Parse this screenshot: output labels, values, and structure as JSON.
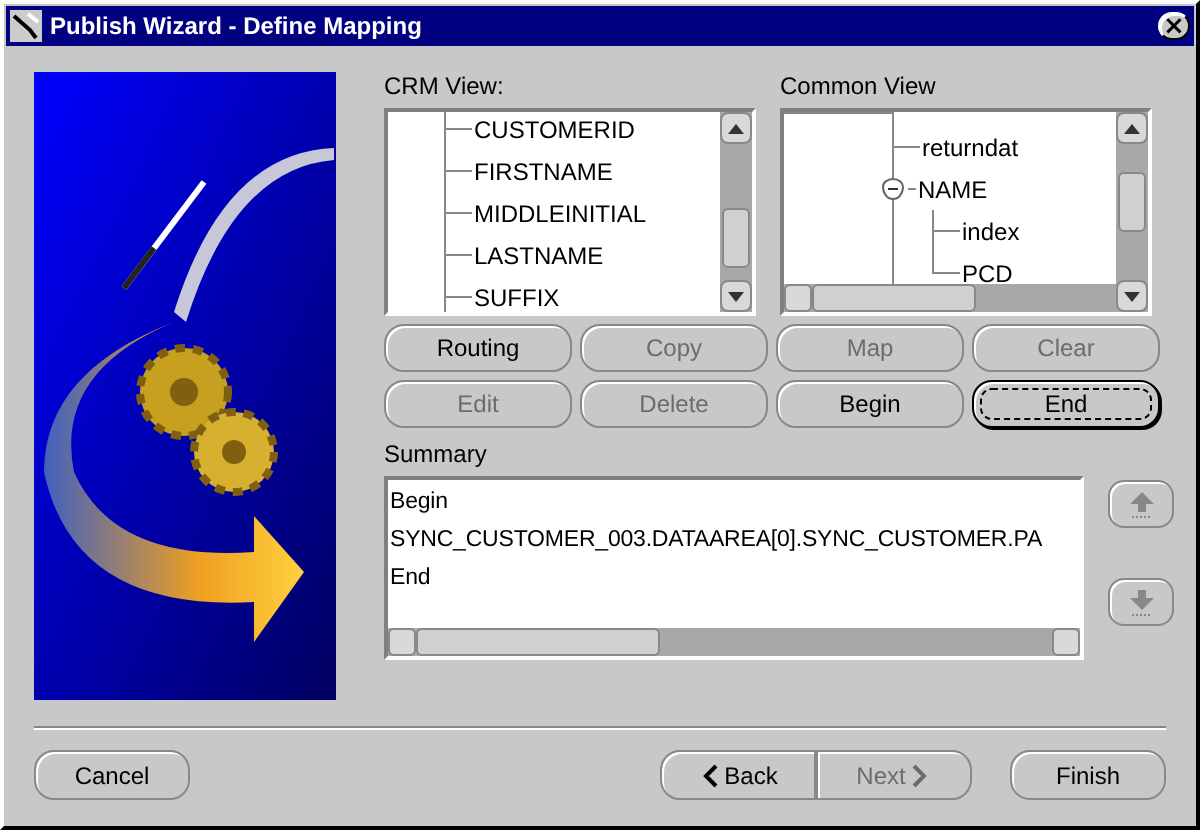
{
  "window": {
    "title": "Publish Wizard - Define Mapping",
    "close": "×"
  },
  "crm_view": {
    "label": "CRM View:",
    "items": [
      {
        "label": "CUSTOMERID"
      },
      {
        "label": "FIRSTNAME"
      },
      {
        "label": "MIDDLEINITIAL"
      },
      {
        "label": "LASTNAME"
      },
      {
        "label": "SUFFIX"
      }
    ]
  },
  "common_view": {
    "label": "Common View",
    "items": [
      {
        "label": "returndat"
      },
      {
        "label": "NAME",
        "expanded": true,
        "children": [
          {
            "label": "index"
          },
          {
            "label": "PCD"
          }
        ]
      }
    ]
  },
  "actions": [
    {
      "label": "Routing",
      "disabled": false,
      "focused": false
    },
    {
      "label": "Copy",
      "disabled": true,
      "focused": false
    },
    {
      "label": "Map",
      "disabled": true,
      "focused": false
    },
    {
      "label": "Clear",
      "disabled": true,
      "focused": false
    },
    {
      "label": "Edit",
      "disabled": true,
      "focused": false
    },
    {
      "label": "Delete",
      "disabled": true,
      "focused": false
    },
    {
      "label": "Begin",
      "disabled": false,
      "focused": false
    },
    {
      "label": "End",
      "disabled": false,
      "focused": true
    }
  ],
  "summary": {
    "label": "Summary",
    "lines": [
      "Begin",
      "SYNC_CUSTOMER_003.DATAAREA[0].SYNC_CUSTOMER.PA",
      "End"
    ]
  },
  "move_buttons": [
    {
      "kind": "up",
      "disabled": true
    },
    {
      "kind": "down",
      "disabled": true
    }
  ],
  "footer": [
    {
      "label": "Cancel",
      "kind": "plain",
      "disabled": false
    },
    {
      "label": "Back",
      "kind": "back",
      "disabled": false
    },
    {
      "label": "Next",
      "kind": "next",
      "disabled": true
    },
    {
      "label": "Finish",
      "kind": "plain",
      "disabled": false
    }
  ]
}
